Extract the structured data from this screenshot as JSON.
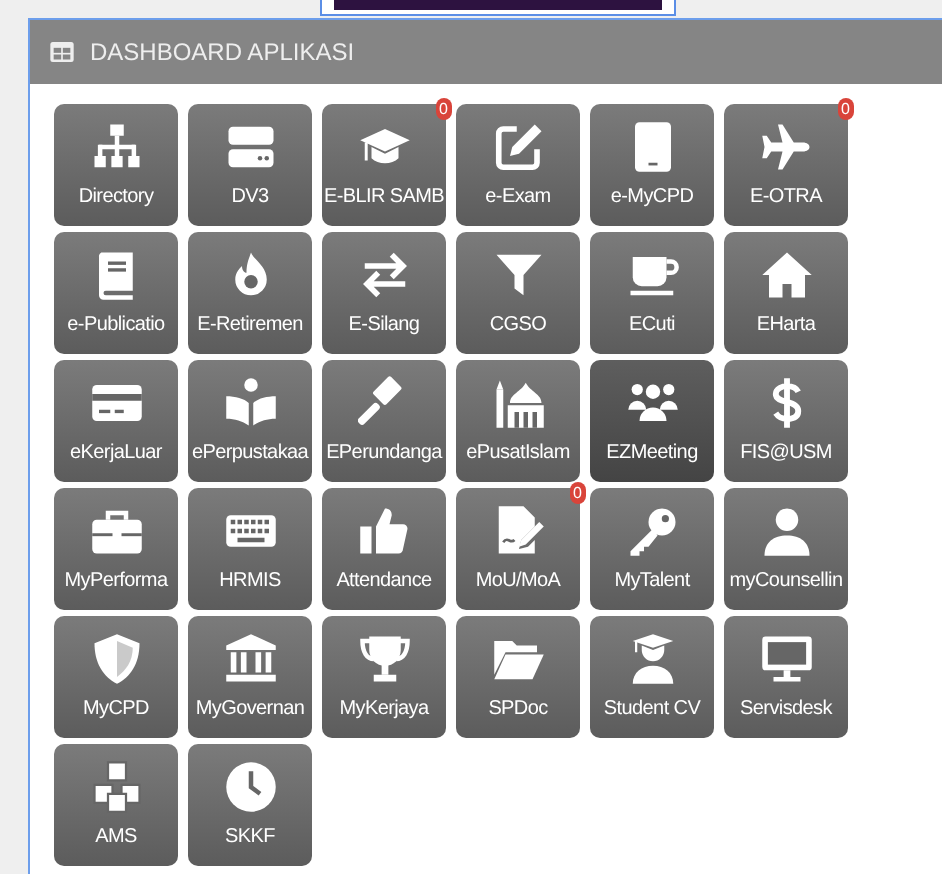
{
  "panel": {
    "title": "DASHBOARD APLIKASI"
  },
  "tiles": [
    {
      "label": "Directory",
      "selected": false
    },
    {
      "label": "DV3",
      "selected": false
    },
    {
      "label": "E-BLIR SAMB",
      "selected": false,
      "badge": "0"
    },
    {
      "label": "e-Exam",
      "selected": false
    },
    {
      "label": "e-MyCPD",
      "selected": false
    },
    {
      "label": "E-OTRA",
      "selected": false,
      "badge": "0"
    },
    {
      "label": "e-Publicatio",
      "selected": false
    },
    {
      "label": "E-Retiremen",
      "selected": false
    },
    {
      "label": "E-Silang",
      "selected": false
    },
    {
      "label": "CGSO",
      "selected": false
    },
    {
      "label": "ECuti",
      "selected": false
    },
    {
      "label": "EHarta",
      "selected": false
    },
    {
      "label": "eKerjaLuar",
      "selected": false
    },
    {
      "label": "ePerpustakaa",
      "selected": false
    },
    {
      "label": "EPerundanga",
      "selected": false
    },
    {
      "label": "ePusatIslam",
      "selected": false
    },
    {
      "label": "EZMeeting",
      "selected": true
    },
    {
      "label": "FIS@USM",
      "selected": false
    },
    {
      "label": "MyPerforma",
      "selected": false
    },
    {
      "label": "HRMIS",
      "selected": false
    },
    {
      "label": "Attendance",
      "selected": false
    },
    {
      "label": "MoU/MoA",
      "selected": false,
      "badge": "0"
    },
    {
      "label": "MyTalent",
      "selected": false
    },
    {
      "label": "myCounsellin",
      "selected": false
    },
    {
      "label": "MyCPD",
      "selected": false
    },
    {
      "label": "MyGovernan",
      "selected": false
    },
    {
      "label": "MyKerjaya",
      "selected": false
    },
    {
      "label": "SPDoc",
      "selected": false
    },
    {
      "label": "Student CV",
      "selected": false
    },
    {
      "label": "Servisdesk",
      "selected": false
    },
    {
      "label": "AMS",
      "selected": false
    },
    {
      "label": "SKKF",
      "selected": false
    }
  ]
}
